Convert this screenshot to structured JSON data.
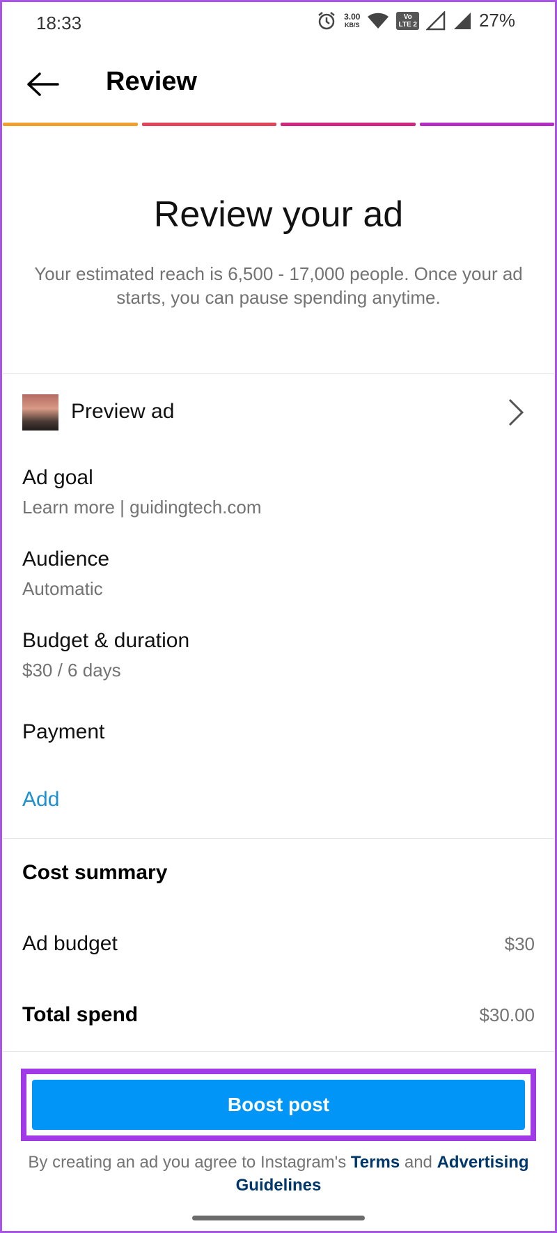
{
  "status_bar": {
    "time": "18:33",
    "net_speed_value": "3.00",
    "net_speed_unit": "KB/S",
    "volte_top": "Vo",
    "volte_bottom": "LTE 2",
    "battery": "27%",
    "icons": [
      "alarm-icon",
      "wifi-icon",
      "volte-icon",
      "signal-icon",
      "signal-icon"
    ]
  },
  "header": {
    "title": "Review",
    "back_icon": "arrow-left-icon",
    "progress_colors": [
      "#f0a030",
      "#e0455a",
      "#d0287f",
      "#b52ec3"
    ]
  },
  "hero": {
    "title": "Review your ad",
    "subtitle": "Your estimated reach is 6,500 - 17,000 people. Once your ad starts, you can pause spending anytime."
  },
  "preview": {
    "label": "Preview ad",
    "chevron_icon": "chevron-right-icon"
  },
  "details": [
    {
      "title": "Ad goal",
      "value": "Learn more | guidingtech.com"
    },
    {
      "title": "Audience",
      "value": "Automatic"
    },
    {
      "title": "Budget & duration",
      "value": "$30 / 6 days"
    }
  ],
  "payment": {
    "title": "Payment",
    "add_label": "Add"
  },
  "cost_summary": {
    "title": "Cost summary",
    "ad_budget_label": "Ad budget",
    "ad_budget_value": "$30",
    "total_label": "Total spend",
    "total_value": "$30.00"
  },
  "boost": {
    "label": "Boost post"
  },
  "legal": {
    "prefix": "By creating an ad you agree to Instagram's ",
    "terms": "Terms",
    "and": " and ",
    "guidelines": "Advertising Guidelines"
  },
  "colors": {
    "accent_blue": "#0195f7",
    "link_blue": "#1d8fd3",
    "highlight_purple": "#a239e6"
  }
}
